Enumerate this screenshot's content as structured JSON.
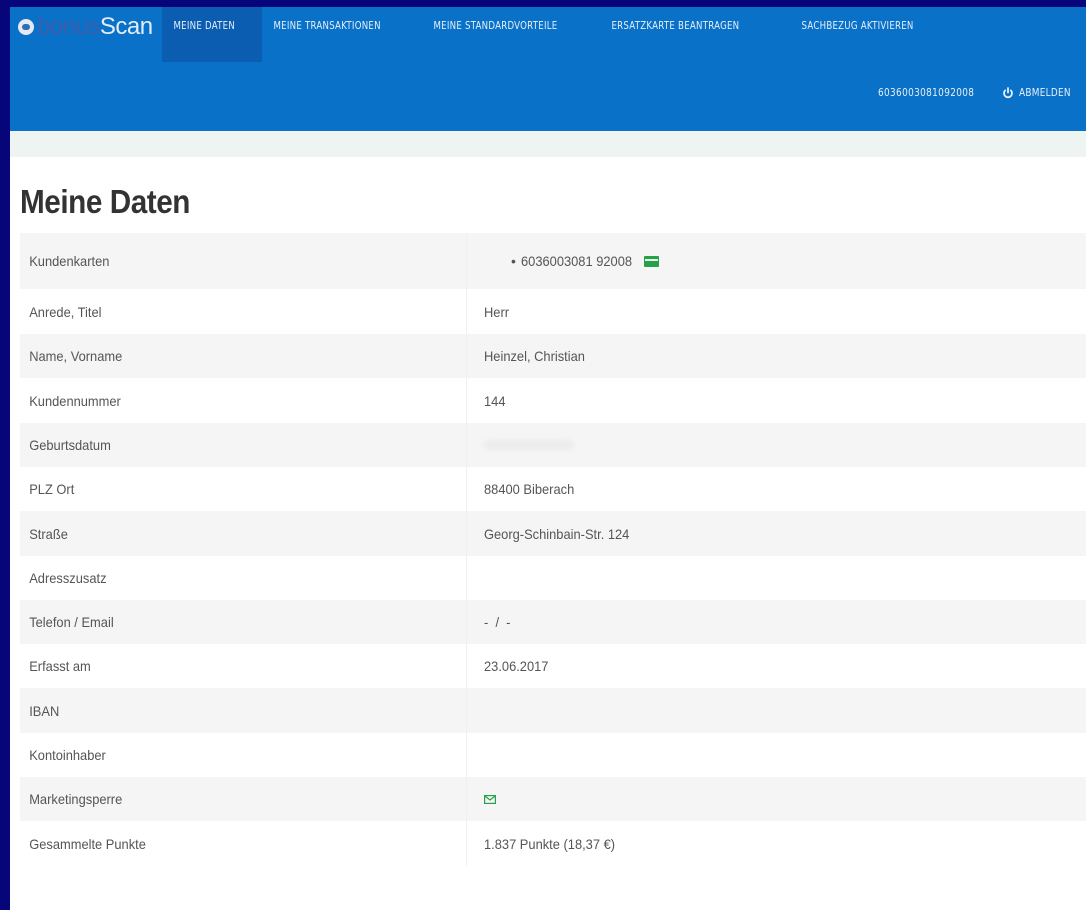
{
  "brand": {
    "part1": "bonus",
    "part2": "Scan"
  },
  "nav": {
    "items": [
      {
        "label": "MEINE DATEN",
        "active": true
      },
      {
        "label": "MEINE TRANSAKTIONEN",
        "active": false
      },
      {
        "label": "MEINE STANDARDVORTEILE",
        "active": false
      },
      {
        "label": "ERSATZKARTE BEANTRAGEN",
        "active": false
      },
      {
        "label": "SACHBEZUG AKTIVIEREN",
        "active": false
      }
    ],
    "card_number": "6036003081092008",
    "logout_label": "ABMELDEN"
  },
  "page": {
    "title": "Meine Daten"
  },
  "details": {
    "rows": [
      {
        "label": "Kundenkarten",
        "value": "6036003081  92008"
      },
      {
        "label": "Anrede, Titel",
        "value": "Herr"
      },
      {
        "label": "Name, Vorname",
        "value": "Heinzel, Christian"
      },
      {
        "label": "Kundennummer",
        "value": "144"
      },
      {
        "label": "Geburtsdatum",
        "value": ""
      },
      {
        "label": "PLZ Ort",
        "value": "88400 Biberach"
      },
      {
        "label": "Straße",
        "value": "Georg-Schinbain-Str. 124"
      },
      {
        "label": "Adresszusatz",
        "value": ""
      },
      {
        "label": "Telefon / Email",
        "value": "-  /  -"
      },
      {
        "label": "Erfasst am",
        "value": "23.06.2017"
      },
      {
        "label": "IBAN",
        "value": ""
      },
      {
        "label": "Kontoinhaber",
        "value": ""
      },
      {
        "label": "Marketingsperre",
        "value": ""
      },
      {
        "label": "Gesammelte Punkte",
        "value": "1.837 Punkte (18,37 €)"
      }
    ]
  },
  "colors": {
    "navbar": "#0a71c8",
    "accent_green": "#27a04a",
    "background": "#06067a"
  },
  "icons": {
    "logo": "bonusscan-logo",
    "logout": "power-icon",
    "card": "credit-card-icon",
    "marketing": "envelope-icon"
  }
}
